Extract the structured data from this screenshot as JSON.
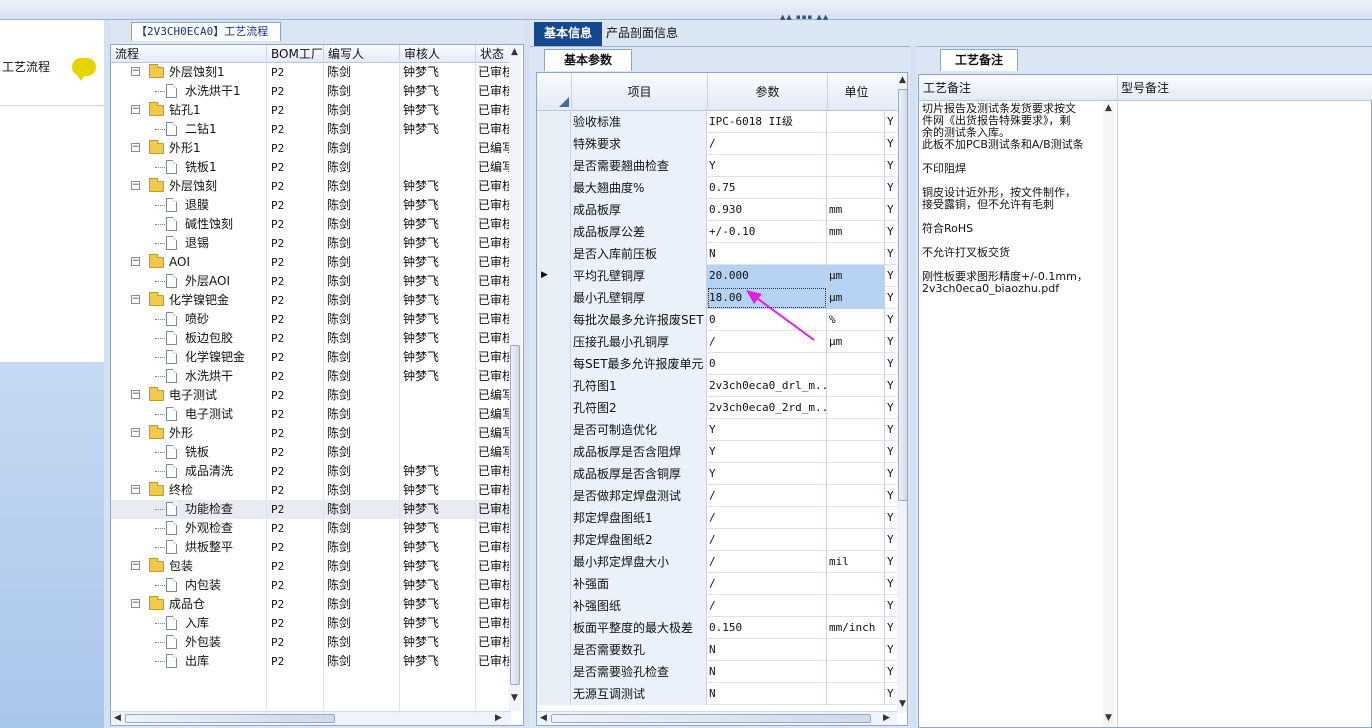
{
  "left_panel": {
    "item_label": "工艺流程"
  },
  "tree_tab_title": "【2V3CH0ECA0】工艺流程",
  "tree": {
    "columns": [
      "流程",
      "BOM工厂",
      "编写人",
      "审核人",
      "状态"
    ],
    "rows": [
      {
        "name": "外层蚀刻1",
        "level": 0,
        "folder": true,
        "bom": "P2",
        "writer": "陈剑",
        "reviewer": "钟梦飞",
        "status": "已审核"
      },
      {
        "name": "水洗烘干1",
        "level": 1,
        "folder": false,
        "bom": "P2",
        "writer": "陈剑",
        "reviewer": "钟梦飞",
        "status": "已审核"
      },
      {
        "name": "钻孔1",
        "level": 0,
        "folder": true,
        "bom": "P2",
        "writer": "陈剑",
        "reviewer": "钟梦飞",
        "status": "已审核"
      },
      {
        "name": "二钻1",
        "level": 1,
        "folder": false,
        "bom": "P2",
        "writer": "陈剑",
        "reviewer": "钟梦飞",
        "status": "已审核"
      },
      {
        "name": "外形1",
        "level": 0,
        "folder": true,
        "bom": "P2",
        "writer": "陈剑",
        "reviewer": "",
        "status": "已编写"
      },
      {
        "name": "铣板1",
        "level": 1,
        "folder": false,
        "bom": "P2",
        "writer": "陈剑",
        "reviewer": "",
        "status": "已编写"
      },
      {
        "name": "外层蚀刻",
        "level": 0,
        "folder": true,
        "bom": "P2",
        "writer": "陈剑",
        "reviewer": "钟梦飞",
        "status": "已审核"
      },
      {
        "name": "退膜",
        "level": 1,
        "folder": false,
        "bom": "P2",
        "writer": "陈剑",
        "reviewer": "钟梦飞",
        "status": "已审核"
      },
      {
        "name": "碱性蚀刻",
        "level": 1,
        "folder": false,
        "bom": "P2",
        "writer": "陈剑",
        "reviewer": "钟梦飞",
        "status": "已审核"
      },
      {
        "name": "退锡",
        "level": 1,
        "folder": false,
        "bom": "P2",
        "writer": "陈剑",
        "reviewer": "钟梦飞",
        "status": "已审核"
      },
      {
        "name": "AOI",
        "level": 0,
        "folder": true,
        "bom": "P2",
        "writer": "陈剑",
        "reviewer": "钟梦飞",
        "status": "已审核"
      },
      {
        "name": "外层AOI",
        "level": 1,
        "folder": false,
        "bom": "P2",
        "writer": "陈剑",
        "reviewer": "钟梦飞",
        "status": "已审核"
      },
      {
        "name": "化学镍钯金",
        "level": 0,
        "folder": true,
        "bom": "P2",
        "writer": "陈剑",
        "reviewer": "钟梦飞",
        "status": "已审核"
      },
      {
        "name": "喷砂",
        "level": 1,
        "folder": false,
        "bom": "P2",
        "writer": "陈剑",
        "reviewer": "钟梦飞",
        "status": "已审核"
      },
      {
        "name": "板边包胶",
        "level": 1,
        "folder": false,
        "bom": "P2",
        "writer": "陈剑",
        "reviewer": "钟梦飞",
        "status": "已审核"
      },
      {
        "name": "化学镍钯金",
        "level": 1,
        "folder": false,
        "bom": "P2",
        "writer": "陈剑",
        "reviewer": "钟梦飞",
        "status": "已审核"
      },
      {
        "name": "水洗烘干",
        "level": 1,
        "folder": false,
        "bom": "P2",
        "writer": "陈剑",
        "reviewer": "钟梦飞",
        "status": "已审核"
      },
      {
        "name": "电子测试",
        "level": 0,
        "folder": true,
        "bom": "P2",
        "writer": "陈剑",
        "reviewer": "",
        "status": "已编写"
      },
      {
        "name": "电子测试",
        "level": 1,
        "folder": false,
        "bom": "P2",
        "writer": "陈剑",
        "reviewer": "",
        "status": "已编写"
      },
      {
        "name": "外形",
        "level": 0,
        "folder": true,
        "bom": "P2",
        "writer": "陈剑",
        "reviewer": "",
        "status": "已编写"
      },
      {
        "name": "铣板",
        "level": 1,
        "folder": false,
        "bom": "P2",
        "writer": "陈剑",
        "reviewer": "",
        "status": "已编写"
      },
      {
        "name": "成品清洗",
        "level": 1,
        "folder": false,
        "bom": "P2",
        "writer": "陈剑",
        "reviewer": "钟梦飞",
        "status": "已审核"
      },
      {
        "name": "终检",
        "level": 0,
        "folder": true,
        "bom": "P2",
        "writer": "陈剑",
        "reviewer": "钟梦飞",
        "status": "已审核"
      },
      {
        "name": "功能检查",
        "level": 1,
        "folder": false,
        "bom": "P2",
        "writer": "陈剑",
        "reviewer": "钟梦飞",
        "status": "已审核",
        "selected": true
      },
      {
        "name": "外观检查",
        "level": 1,
        "folder": false,
        "bom": "P2",
        "writer": "陈剑",
        "reviewer": "钟梦飞",
        "status": "已审核"
      },
      {
        "name": "烘板整平",
        "level": 1,
        "folder": false,
        "bom": "P2",
        "writer": "陈剑",
        "reviewer": "钟梦飞",
        "status": "已审核"
      },
      {
        "name": "包装",
        "level": 0,
        "folder": true,
        "bom": "P2",
        "writer": "陈剑",
        "reviewer": "钟梦飞",
        "status": "已审核"
      },
      {
        "name": "内包装",
        "level": 1,
        "folder": false,
        "bom": "P2",
        "writer": "陈剑",
        "reviewer": "钟梦飞",
        "status": "已审核"
      },
      {
        "name": "成品仓",
        "level": 0,
        "folder": true,
        "bom": "P2",
        "writer": "陈剑",
        "reviewer": "钟梦飞",
        "status": "已审核"
      },
      {
        "name": "入库",
        "level": 1,
        "folder": false,
        "bom": "P2",
        "writer": "陈剑",
        "reviewer": "钟梦飞",
        "status": "已审核"
      },
      {
        "name": "外包装",
        "level": 1,
        "folder": false,
        "bom": "P2",
        "writer": "陈剑",
        "reviewer": "钟梦飞",
        "status": "已审核"
      },
      {
        "name": "出库",
        "level": 1,
        "folder": false,
        "bom": "P2",
        "writer": "陈剑",
        "reviewer": "钟梦飞",
        "status": "已审核"
      }
    ]
  },
  "mid_tabs": [
    "基本信息",
    "产品剖面信息"
  ],
  "params_tab": "基本参数",
  "params": {
    "columns": [
      "项目",
      "参数",
      "单位"
    ],
    "rows": [
      {
        "item": "验收标准",
        "value": "IPC-6018 II级",
        "unit": "",
        "flag": "Y"
      },
      {
        "item": "特殊要求",
        "value": "/",
        "unit": "",
        "flag": "Y"
      },
      {
        "item": "是否需要翘曲检查",
        "value": "Y",
        "unit": "",
        "flag": "Y"
      },
      {
        "item": "最大翘曲度%",
        "value": "0.75",
        "unit": "",
        "flag": "Y"
      },
      {
        "item": "成品板厚",
        "value": "0.930",
        "unit": "mm",
        "flag": "Y"
      },
      {
        "item": "成品板厚公差",
        "value": "+/-0.10",
        "unit": "mm",
        "flag": "Y"
      },
      {
        "item": "是否入库前压板",
        "value": "N",
        "unit": "",
        "flag": "Y"
      },
      {
        "item": "平均孔壁铜厚",
        "value": "20.000",
        "unit": "μm",
        "flag": "Y",
        "highlight": true,
        "current": true
      },
      {
        "item": "最小孔壁铜厚",
        "value": "18.00",
        "unit": "μm",
        "flag": "Y",
        "highlight": true,
        "editing": true
      },
      {
        "item": "每批次最多允许报废SET",
        "value": "0",
        "unit": "%",
        "flag": "Y"
      },
      {
        "item": "压接孔最小孔铜厚",
        "value": "/",
        "unit": "μm",
        "flag": "Y"
      },
      {
        "item": "每SET最多允许报废单元",
        "value": "0",
        "unit": "",
        "flag": "Y"
      },
      {
        "item": "孔符图1",
        "value": "2v3ch0eca0_drl_m...",
        "unit": "",
        "flag": "Y"
      },
      {
        "item": "孔符图2",
        "value": "2v3ch0eca0_2rd_m...",
        "unit": "",
        "flag": "Y"
      },
      {
        "item": "是否可制造优化",
        "value": "Y",
        "unit": "",
        "flag": "Y"
      },
      {
        "item": "成品板厚是否含阻焊",
        "value": "Y",
        "unit": "",
        "flag": "Y"
      },
      {
        "item": "成品板厚是否含铜厚",
        "value": "Y",
        "unit": "",
        "flag": "Y"
      },
      {
        "item": "是否做邦定焊盘测试",
        "value": "/",
        "unit": "",
        "flag": "Y"
      },
      {
        "item": "邦定焊盘图纸1",
        "value": "/",
        "unit": "",
        "flag": "Y"
      },
      {
        "item": "邦定焊盘图纸2",
        "value": "/",
        "unit": "",
        "flag": "Y"
      },
      {
        "item": "最小邦定焊盘大小",
        "value": "/",
        "unit": "mil",
        "flag": "Y"
      },
      {
        "item": "补强面",
        "value": "/",
        "unit": "",
        "flag": "Y"
      },
      {
        "item": "补强图纸",
        "value": "/",
        "unit": "",
        "flag": "Y"
      },
      {
        "item": "板面平整度的最大极差",
        "value": "0.150",
        "unit": "mm/inch",
        "flag": "Y"
      },
      {
        "item": "是否需要数孔",
        "value": "N",
        "unit": "",
        "flag": "Y"
      },
      {
        "item": "是否需要验孔检查",
        "value": "N",
        "unit": "",
        "flag": "Y"
      },
      {
        "item": "无源互调测试",
        "value": "N",
        "unit": "",
        "flag": "Y"
      }
    ]
  },
  "right_tab": "工艺备注",
  "notes": {
    "columns": [
      "工艺备注",
      "型号备注"
    ],
    "text": "切片报告及测试条发货要求按文\n件网《出货报告特殊要求》，剩\n余的测试条入库。\n此板不加PCB测试条和A/B测试条\n\n不印阻焊\n\n铜皮设计近外形，按文件制作，\n接受露铜，但不允许有毛刺\n\n符合RoHS\n\n不允许打叉板交货\n\n刚性板要求图形精度+/-0.1mm，\n2v3ch0eca0_biaozhu.pdf"
  },
  "accent": {
    "tab_active": "#14498f",
    "highlight": "#b6d2f2",
    "arrow": "#e020e0"
  }
}
